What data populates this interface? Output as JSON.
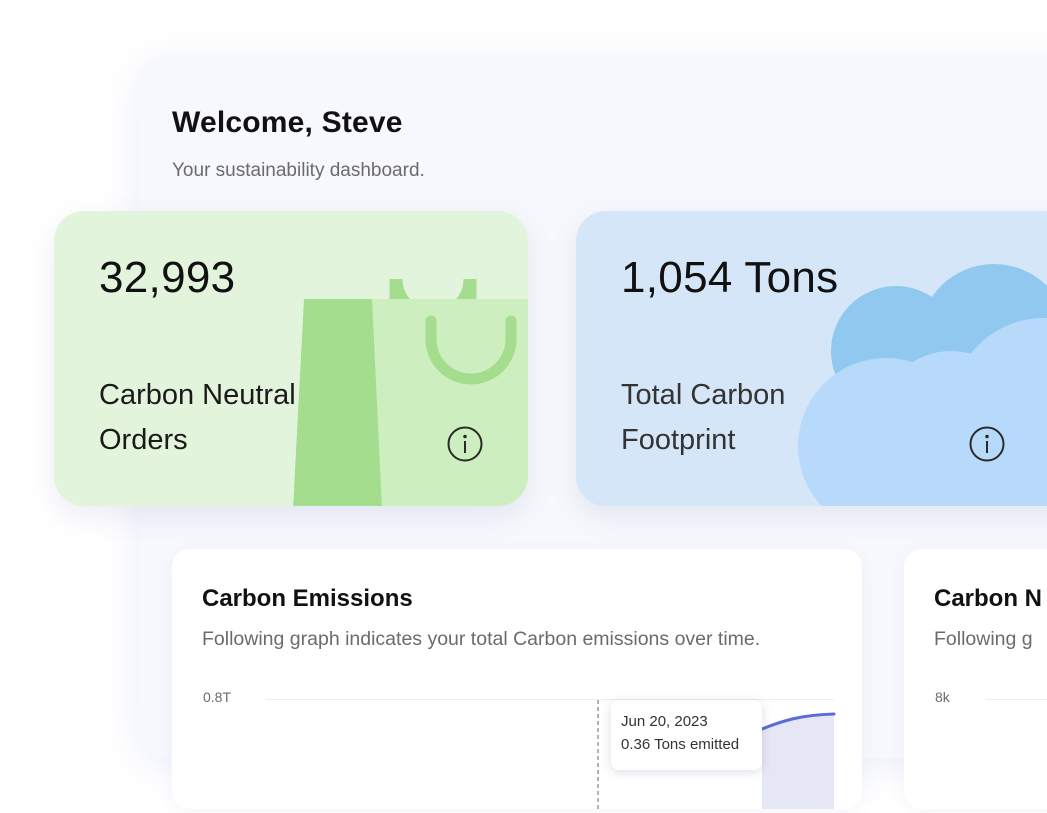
{
  "header": {
    "title": "Welcome, Steve",
    "subtitle": "Your sustainability dashboard."
  },
  "stats": [
    {
      "value": "32,993",
      "label_line1": "Carbon Neutral",
      "label_line2": "Orders",
      "icon": "shopping-bag-icon",
      "color": "#e3f4dc"
    },
    {
      "value": "1,054 Tons",
      "label_line1": "Total Carbon",
      "label_line2": "Footprint",
      "icon": "cloud-icon",
      "color": "#d5e6f8"
    }
  ],
  "charts": [
    {
      "title": "Carbon Emissions",
      "description": "Following graph indicates your total Carbon emissions over time.",
      "y_tick_top": "0.8T",
      "tooltip": {
        "date": "Jun 20, 2023",
        "value": "0.36 Tons emitted"
      },
      "accent": "#5b6bd8"
    },
    {
      "title": "Carbon N",
      "description": "Following g",
      "y_tick_top": "8k"
    }
  ]
}
